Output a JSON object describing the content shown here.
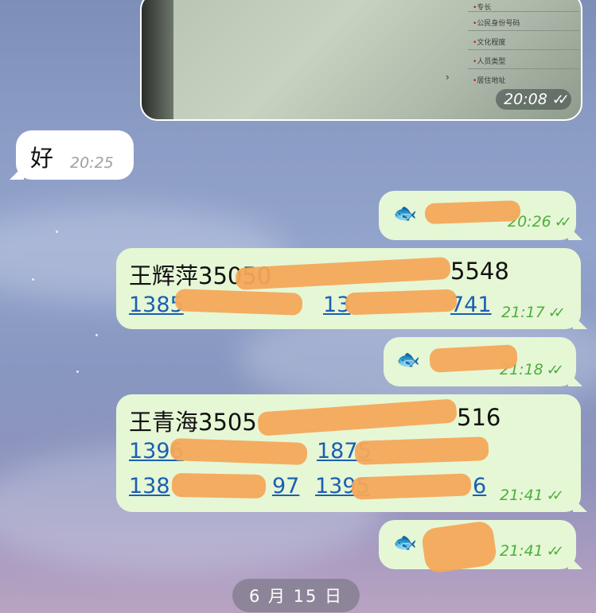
{
  "chat": {
    "photo_message": {
      "form_labels": [
        "专长",
        "公民身份号码",
        "文化程度",
        "人员类型",
        "居住地址"
      ],
      "time": "20:08"
    },
    "incoming_1": {
      "text": "好",
      "time": "20:25"
    },
    "outgoing_1": {
      "time": "20:26",
      "fish": "🐟"
    },
    "outgoing_2": {
      "line1": "王辉萍35050",
      "line1_tail": "5548",
      "phone1": "1385",
      "phone2": "13",
      "phone2_tail": "741",
      "time": "21:17"
    },
    "outgoing_3": {
      "time": "21:18",
      "fish": "🐟"
    },
    "outgoing_4": {
      "line1": "王青海3505",
      "line1_tail": "516",
      "phone1": "1396",
      "phone2": "1875",
      "phone3": "138",
      "phone3_tail": "97",
      "phone4": "1395",
      "phone4_tail": "6",
      "time": "21:41"
    },
    "outgoing_5": {
      "time": "21:41",
      "fish": "🐟"
    },
    "date_separator": "6 月 15 日"
  },
  "colors": {
    "outgoing_bubble": "#e6f7d6",
    "incoming_bubble": "#ffffff",
    "link": "#1a5fb4",
    "read_check": "#4caf3c",
    "redaction": "#f4a85a"
  }
}
